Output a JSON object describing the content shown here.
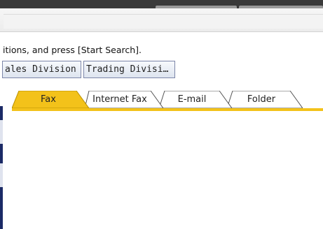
{
  "instruction": {
    "text": "itions, and press [Start Search]."
  },
  "divisions": {
    "sales_label": "ales Division",
    "trading_label": "Trading Divisi…"
  },
  "tabs": [
    {
      "label": "Fax",
      "active": true
    },
    {
      "label": "Internet Fax",
      "active": false
    },
    {
      "label": "E-mail",
      "active": false
    },
    {
      "label": "Folder",
      "active": false
    }
  ],
  "colors": {
    "active_tab": "#f3c21a",
    "inactive_tab": "#ffffff",
    "accent_navy": "#1b2a66",
    "button_border": "#7c86a8"
  }
}
